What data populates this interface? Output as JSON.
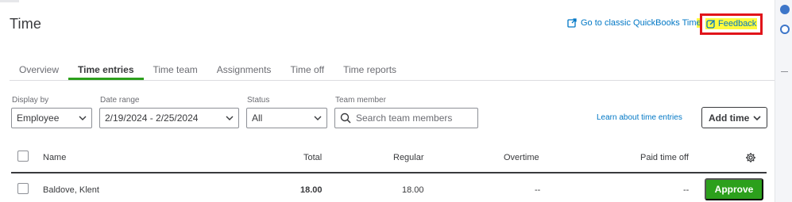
{
  "header": {
    "title": "Time",
    "classic_link": "Go to classic QuickBooks Tim",
    "classic_link_tail": "e",
    "feedback": "Feedback"
  },
  "tabs": [
    {
      "label": "Overview",
      "active": false
    },
    {
      "label": "Time entries",
      "active": true
    },
    {
      "label": "Time team",
      "active": false
    },
    {
      "label": "Assignments",
      "active": false
    },
    {
      "label": "Time off",
      "active": false
    },
    {
      "label": "Time reports",
      "active": false
    }
  ],
  "filters": {
    "display_by": {
      "label": "Display by",
      "value": "Employee"
    },
    "date_range": {
      "label": "Date range",
      "value": "2/19/2024 - 2/25/2024"
    },
    "status": {
      "label": "Status",
      "value": "All"
    },
    "team_member": {
      "label": "Team member",
      "placeholder": "Search team members"
    }
  },
  "actions": {
    "learn_link": "Learn about time entries",
    "add_time": "Add time"
  },
  "table": {
    "columns": {
      "name": "Name",
      "total": "Total",
      "regular": "Regular",
      "overtime": "Overtime",
      "paid_time_off": "Paid time off"
    },
    "rows": [
      {
        "name": "Baldove, Klent",
        "total": "18.00",
        "regular": "18.00",
        "overtime": "--",
        "paid_time_off": "--",
        "action": "Approve"
      }
    ]
  },
  "colors": {
    "accent_green": "#2ca01c",
    "link_blue": "#0077c5",
    "highlight_yellow": "#fffb3d",
    "annotation_red": "#e1141a"
  },
  "icons": [
    "external-link-icon",
    "feedback-icon",
    "chevron-down-icon",
    "search-icon",
    "gear-icon"
  ]
}
